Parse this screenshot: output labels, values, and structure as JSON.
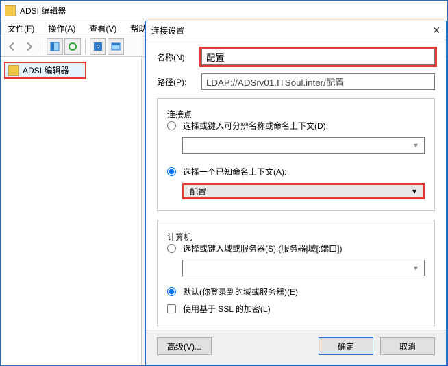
{
  "window": {
    "title": "ADSI 编辑器"
  },
  "menu": {
    "file": "文件(F)",
    "action": "操作(A)",
    "view": "查看(V)",
    "help": "帮助(H"
  },
  "tree": {
    "root_label": "ADSI 编辑器"
  },
  "dialog": {
    "title": "连接设置",
    "name_label": "名称(N):",
    "name_value": "配置",
    "path_label": "路径(P):",
    "path_value": "LDAP://ADSrv01.ITSoul.inter/配置",
    "group1": {
      "legend": "连接点",
      "radio_dn": "选择或键入可分辨名称或命名上下文(D):",
      "radio_naming": "选择一个已知命名上下文(A):",
      "selected_value": "配置"
    },
    "group2": {
      "legend": "计算机",
      "radio_server": "选择或键入域或服务器(S):(服务器|域[:端口])",
      "radio_default": "默认(你登录到的域或服务器)(E)",
      "checkbox_ssl": "使用基于 SSL 的加密(L)"
    },
    "buttons": {
      "advanced": "高级(V)...",
      "ok": "确定",
      "cancel": "取消"
    }
  }
}
